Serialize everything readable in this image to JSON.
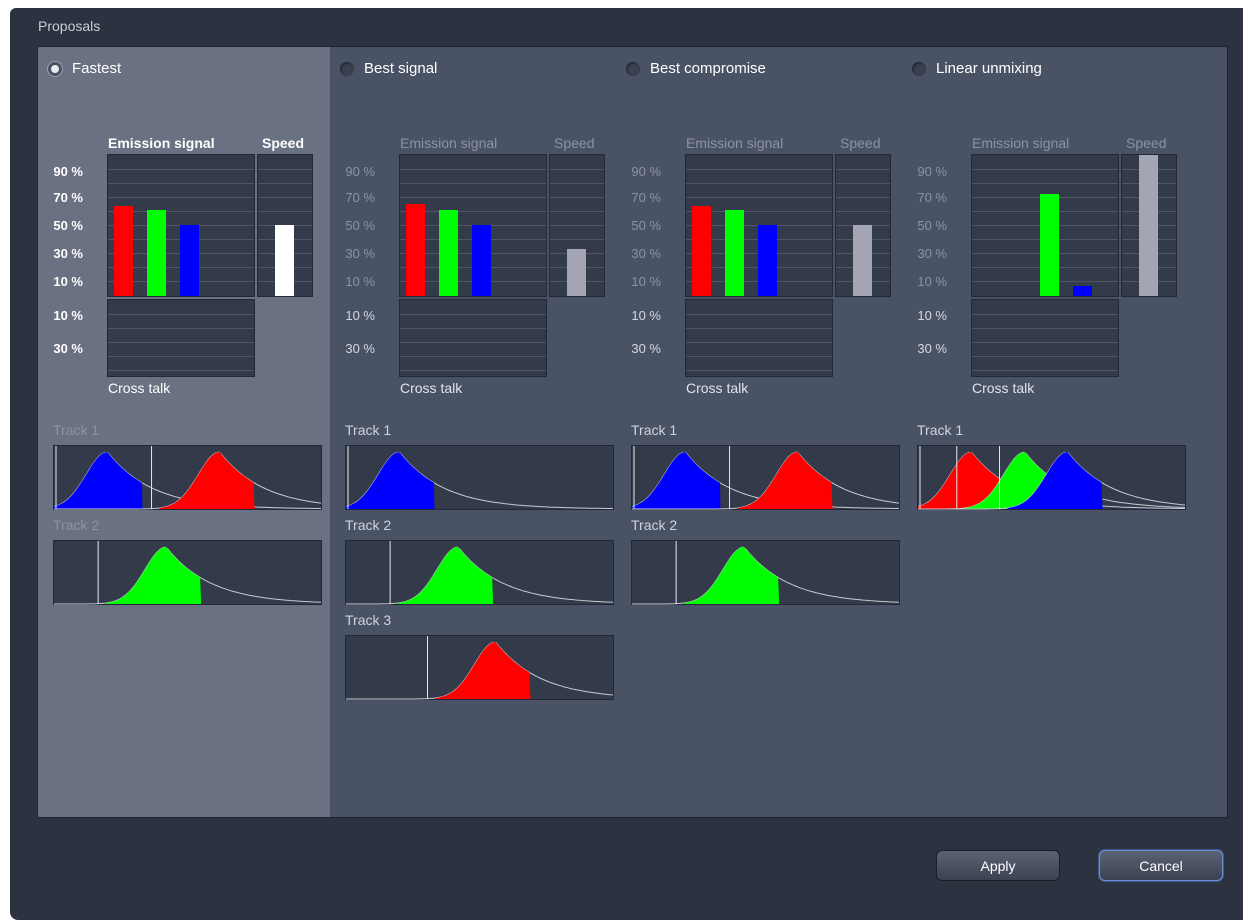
{
  "group_title": "Proposals",
  "buttons": {
    "apply": "Apply",
    "cancel": "Cancel"
  },
  "headers": {
    "emission": "Emission signal",
    "speed": "Speed",
    "crosstalk": "Cross talk"
  },
  "pos_ticks": [
    "90 %",
    "70 %",
    "50 %",
    "30 %",
    "10 %"
  ],
  "neg_ticks": [
    "10 %",
    "30 %"
  ],
  "colors": {
    "red": "#ff0000",
    "green": "#00ff00",
    "blue": "#0000ff",
    "speed_selected": "#ffffff",
    "speed_other": "#a3a6b2"
  },
  "proposals": [
    {
      "label": "Fastest",
      "selected": true,
      "emission": [
        {
          "color": "red",
          "value": 64
        },
        {
          "color": "green",
          "value": 61
        },
        {
          "color": "blue",
          "value": 50
        }
      ],
      "speed": 50,
      "tracks": [
        {
          "label": "Track 1",
          "spectra": [
            {
              "color": "blue",
              "peak": 0.2
            },
            {
              "color": "red",
              "peak": 0.62
            }
          ]
        },
        {
          "label": "Track 2",
          "spectra": [
            {
              "color": "green",
              "peak": 0.42
            }
          ]
        }
      ]
    },
    {
      "label": "Best signal",
      "selected": false,
      "emission": [
        {
          "color": "red",
          "value": 65
        },
        {
          "color": "green",
          "value": 61
        },
        {
          "color": "blue",
          "value": 50
        }
      ],
      "speed": 33,
      "tracks": [
        {
          "label": "Track 1",
          "spectra": [
            {
              "color": "blue",
              "peak": 0.2
            }
          ]
        },
        {
          "label": "Track 2",
          "spectra": [
            {
              "color": "green",
              "peak": 0.42
            }
          ]
        },
        {
          "label": "Track 3",
          "spectra": [
            {
              "color": "red",
              "peak": 0.56
            }
          ]
        }
      ]
    },
    {
      "label": "Best compromise",
      "selected": false,
      "emission": [
        {
          "color": "red",
          "value": 64
        },
        {
          "color": "green",
          "value": 61
        },
        {
          "color": "blue",
          "value": 50
        }
      ],
      "speed": 50,
      "tracks": [
        {
          "label": "Track 1",
          "spectra": [
            {
              "color": "blue",
              "peak": 0.2
            },
            {
              "color": "red",
              "peak": 0.62
            }
          ]
        },
        {
          "label": "Track 2",
          "spectra": [
            {
              "color": "green",
              "peak": 0.42
            }
          ]
        }
      ]
    },
    {
      "label": "Linear unmixing",
      "selected": false,
      "emission": [
        {
          "color": "green",
          "value": 72
        },
        {
          "color": "blue",
          "value": 7
        }
      ],
      "speed": 100,
      "tracks": [
        {
          "label": "Track 1",
          "spectra": [
            {
              "color": "red",
              "peak": 0.2
            },
            {
              "color": "green",
              "peak": 0.4
            },
            {
              "color": "blue",
              "peak": 0.56
            }
          ]
        }
      ]
    }
  ]
}
